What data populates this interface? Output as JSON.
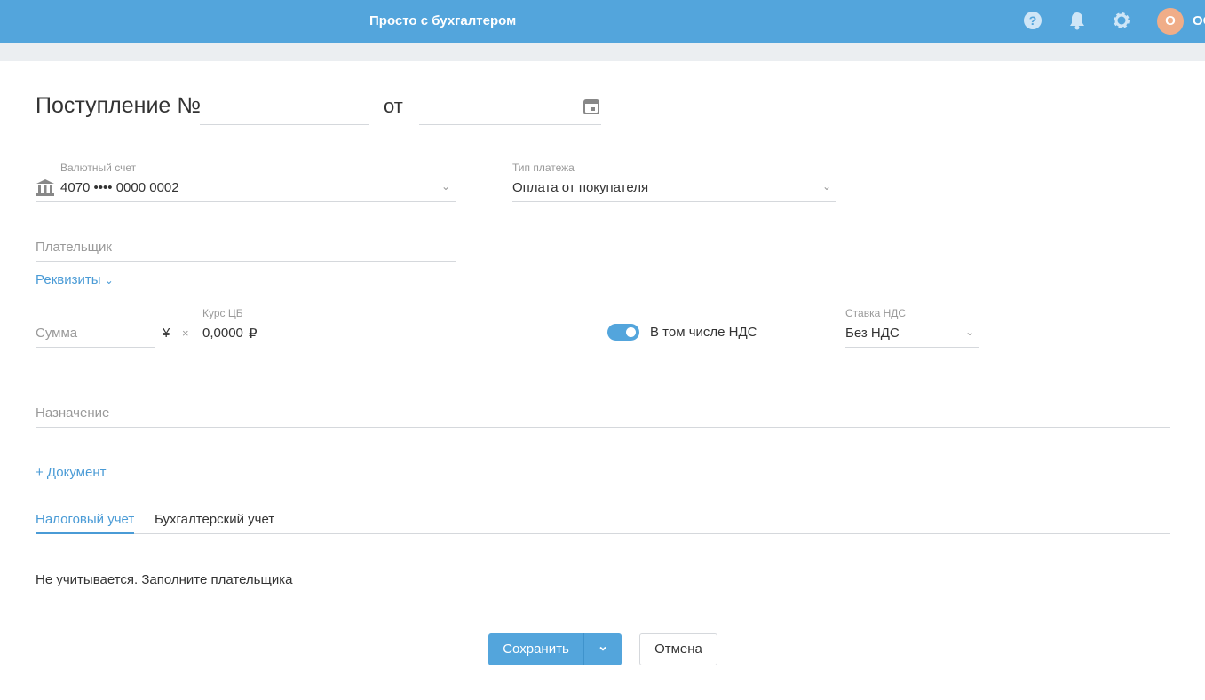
{
  "header": {
    "brand": "Просто с бухгалтером",
    "avatar_letter": "О",
    "user_name": "ОО"
  },
  "title": {
    "label": "Поступление №",
    "number": "",
    "from": "от",
    "date": ""
  },
  "account": {
    "label": "Валютный счет",
    "value": "4070 •••• 0000 0002"
  },
  "payment_type": {
    "label": "Тип платежа",
    "value": "Оплата от покупателя"
  },
  "payer": {
    "placeholder": "Плательщик"
  },
  "requisites": "Реквизиты",
  "amount": {
    "placeholder": "Сумма",
    "currency": "¥",
    "times": "×",
    "rate_label": "Курс ЦБ",
    "rate": "0,0000",
    "rub": "₽"
  },
  "vat": {
    "toggle_label": "В том числе НДС",
    "toggle_on": true,
    "rate_label": "Ставка НДС",
    "rate_value": "Без НДС"
  },
  "purpose": {
    "placeholder": "Назначение"
  },
  "add_document": "+ Документ",
  "tabs": [
    {
      "label": "Налоговый учет",
      "active": true
    },
    {
      "label": "Бухгалтерский учет",
      "active": false
    }
  ],
  "tab_content": "Не учитывается. Заполните плательщика",
  "buttons": {
    "save": "Сохранить",
    "cancel": "Отмена"
  }
}
